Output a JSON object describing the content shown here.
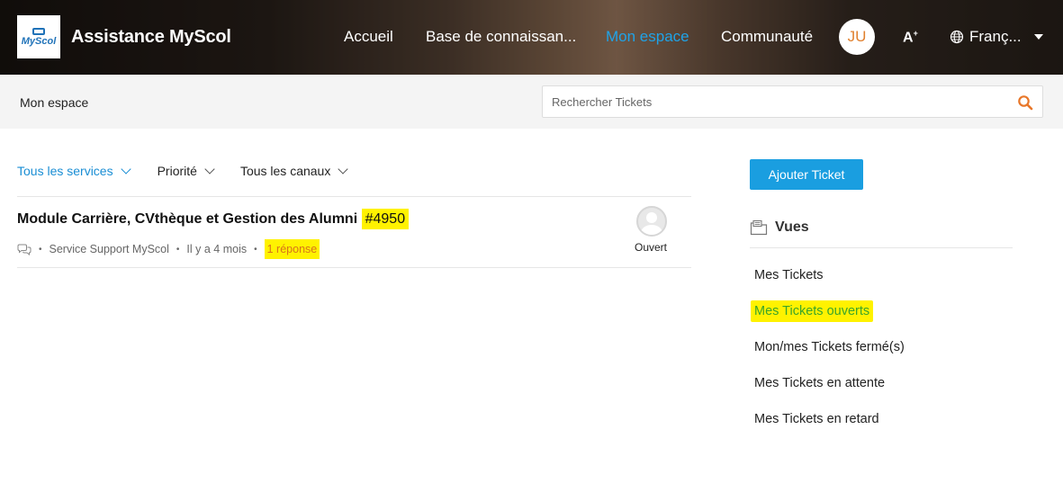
{
  "header": {
    "logo_text": "MyScol",
    "brand": "Assistance MyScol",
    "nav": [
      {
        "label": "Accueil",
        "active": false
      },
      {
        "label": "Base de connaissan...",
        "active": false
      },
      {
        "label": "Mon espace",
        "active": true
      },
      {
        "label": "Communauté",
        "active": false
      }
    ],
    "avatar_initials": "JU",
    "font_size_label": "A",
    "language": "Franç..."
  },
  "subbar": {
    "title": "Mon espace",
    "search_placeholder": "Rechercher Tickets"
  },
  "filters": [
    {
      "label": "Tous les services"
    },
    {
      "label": "Priorité"
    },
    {
      "label": "Tous les canaux"
    }
  ],
  "ticket": {
    "title": "Module Carrière, CVthèque et Gestion des Alumni",
    "id": "#4950",
    "department": "Service Support MyScol",
    "time": "Il y a 4 mois",
    "replies": "1 réponse",
    "status": "Ouvert"
  },
  "sidebar": {
    "add_button": "Ajouter Ticket",
    "views_title": "Vues",
    "views": [
      {
        "label": "Mes Tickets",
        "active": false
      },
      {
        "label": "Mes Tickets ouverts",
        "active": true
      },
      {
        "label": "Mon/mes Tickets fermé(s)",
        "active": false
      },
      {
        "label": "Mes Tickets en attente",
        "active": false
      },
      {
        "label": "Mes Tickets en retard",
        "active": false
      }
    ]
  },
  "colors": {
    "accent": "#1a9ee0",
    "highlight": "#fff200",
    "active_view": "#3aa52a"
  }
}
